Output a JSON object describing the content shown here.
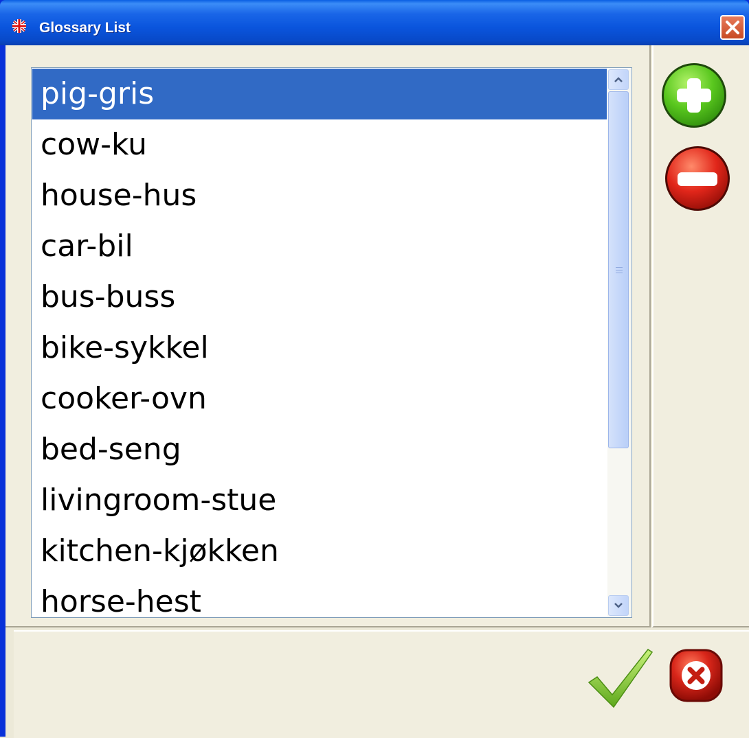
{
  "window": {
    "title": "Glossary List",
    "accent": "#0A55DD"
  },
  "glossary": {
    "items": [
      "pig-gris",
      "cow-ku",
      "house-hus",
      "car-bil",
      "bus-buss",
      "bike-sykkel",
      "cooker-ovn",
      "bed-seng",
      "livingroom-stue",
      "kitchen-kjøkken",
      "horse-hest"
    ],
    "selected": "pig-gris"
  },
  "icons": {
    "window_icon": "uk-flag-icon",
    "add": "plus-circle-icon",
    "remove": "minus-circle-icon",
    "ok": "checkmark-icon",
    "cancel": "x-circle-icon",
    "close": "close-icon"
  }
}
